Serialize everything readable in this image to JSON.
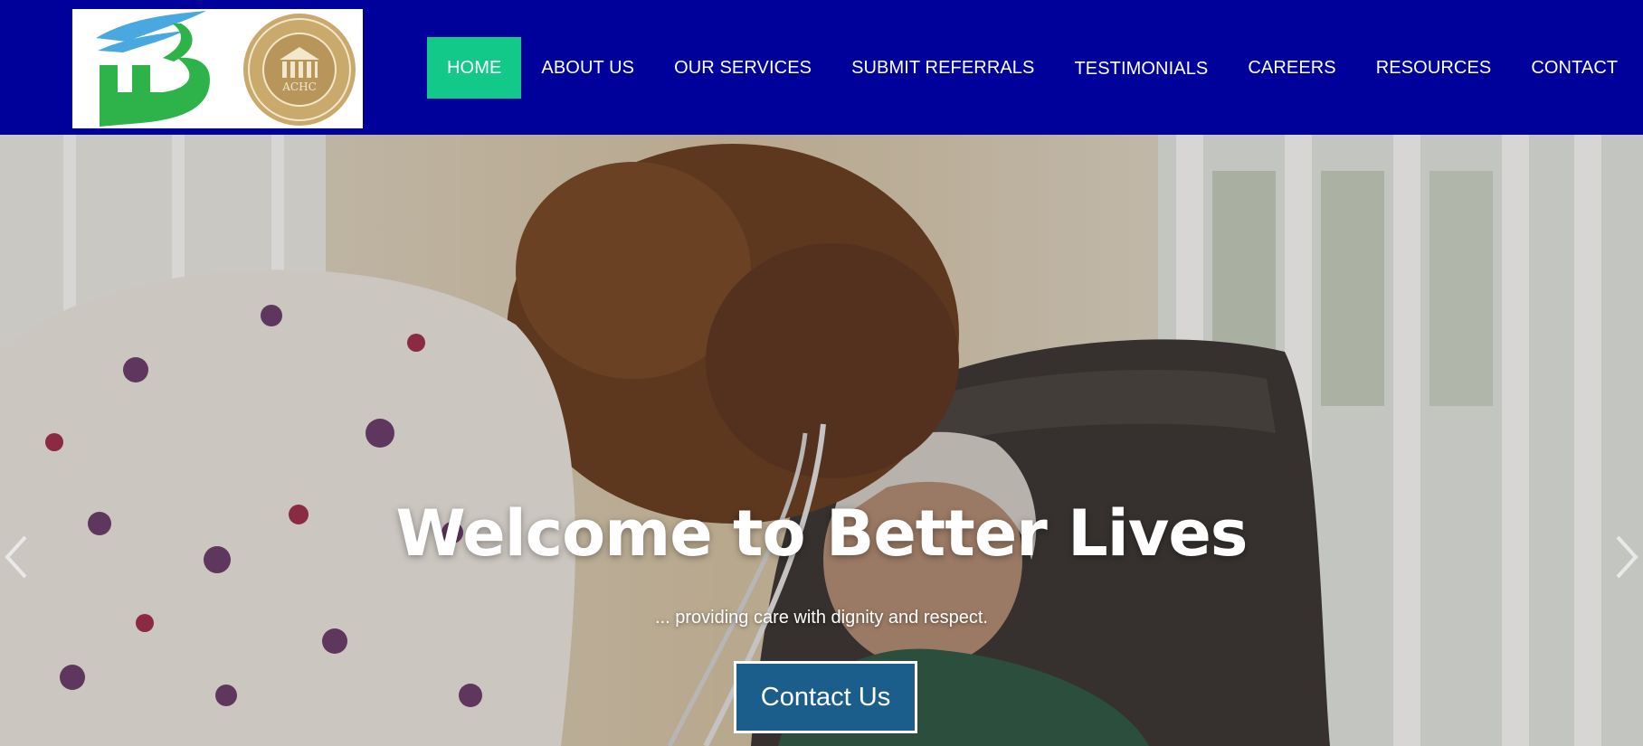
{
  "header": {
    "logo_alt": "Better Lives logo",
    "seal_text": "ACHC",
    "nav": [
      {
        "label": "HOME",
        "active": true
      },
      {
        "label": "ABOUT US",
        "active": false
      },
      {
        "label": "OUR SERVICES",
        "active": false
      },
      {
        "label": "SUBMIT REFERRALS",
        "active": false
      },
      {
        "label": "TESTIMONIALS",
        "active": false
      },
      {
        "label": "CAREERS",
        "active": false
      },
      {
        "label": "RESOURCES",
        "active": false
      },
      {
        "label": "CONTACT",
        "active": false
      }
    ]
  },
  "hero": {
    "title": "Welcome to Better Lives",
    "subtitle": "... providing care with dignity and respect.",
    "cta_label": "Contact Us",
    "prev_icon": "chevron-left-icon",
    "next_icon": "chevron-right-icon"
  },
  "colors": {
    "header_bg": "#00009a",
    "active_nav": "#12c98a",
    "cta_bg": "#1b5e8c",
    "logo_green": "#2db34a",
    "logo_blue": "#4aa8e0",
    "seal_gold": "#b8955a"
  }
}
